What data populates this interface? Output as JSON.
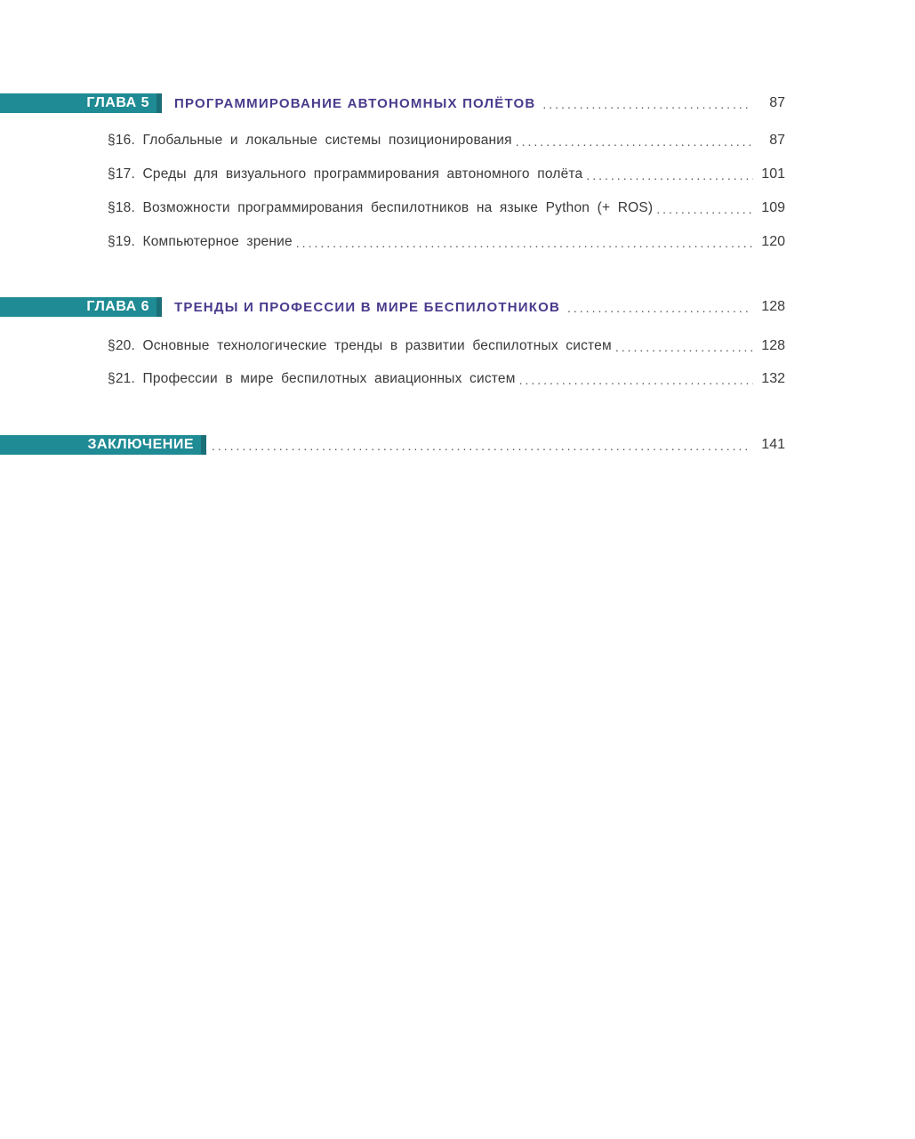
{
  "chapters": [
    {
      "label": "ГЛАВА 5",
      "title": "ПРОГРАММИРОВАНИЕ АВТОНОМНЫХ ПОЛЁТОВ",
      "page": "87",
      "sections": [
        {
          "title": "§16. Глобальные и локальные системы позиционирования",
          "page": "87"
        },
        {
          "title": "§17. Среды для визуального программирования автономного полёта",
          "page": "101"
        },
        {
          "title": "§18. Возможности программирования беспилотников на языке Python (+ ROS)",
          "page": "109"
        },
        {
          "title": "§19. Компьютерное зрение",
          "page": "120"
        }
      ]
    },
    {
      "label": "ГЛАВА 6",
      "title": "ТРЕНДЫ И ПРОФЕССИИ В МИРЕ БЕСПИЛОТНИКОВ",
      "page": "128",
      "sections": [
        {
          "title": "§20. Основные технологические тренды в развитии беспилотных систем",
          "page": "128"
        },
        {
          "title": "§21. Профессии в мире беспилотных авиационных систем",
          "page": "132"
        }
      ]
    }
  ],
  "conclusion": {
    "label": "ЗАКЛЮЧЕНИЕ",
    "page": "141"
  },
  "colors": {
    "tab_fill": "#1f8b94",
    "tab_edge": "#1b6f77",
    "chapter_title": "#4a3a8c",
    "body_text": "#3a3a3a"
  }
}
